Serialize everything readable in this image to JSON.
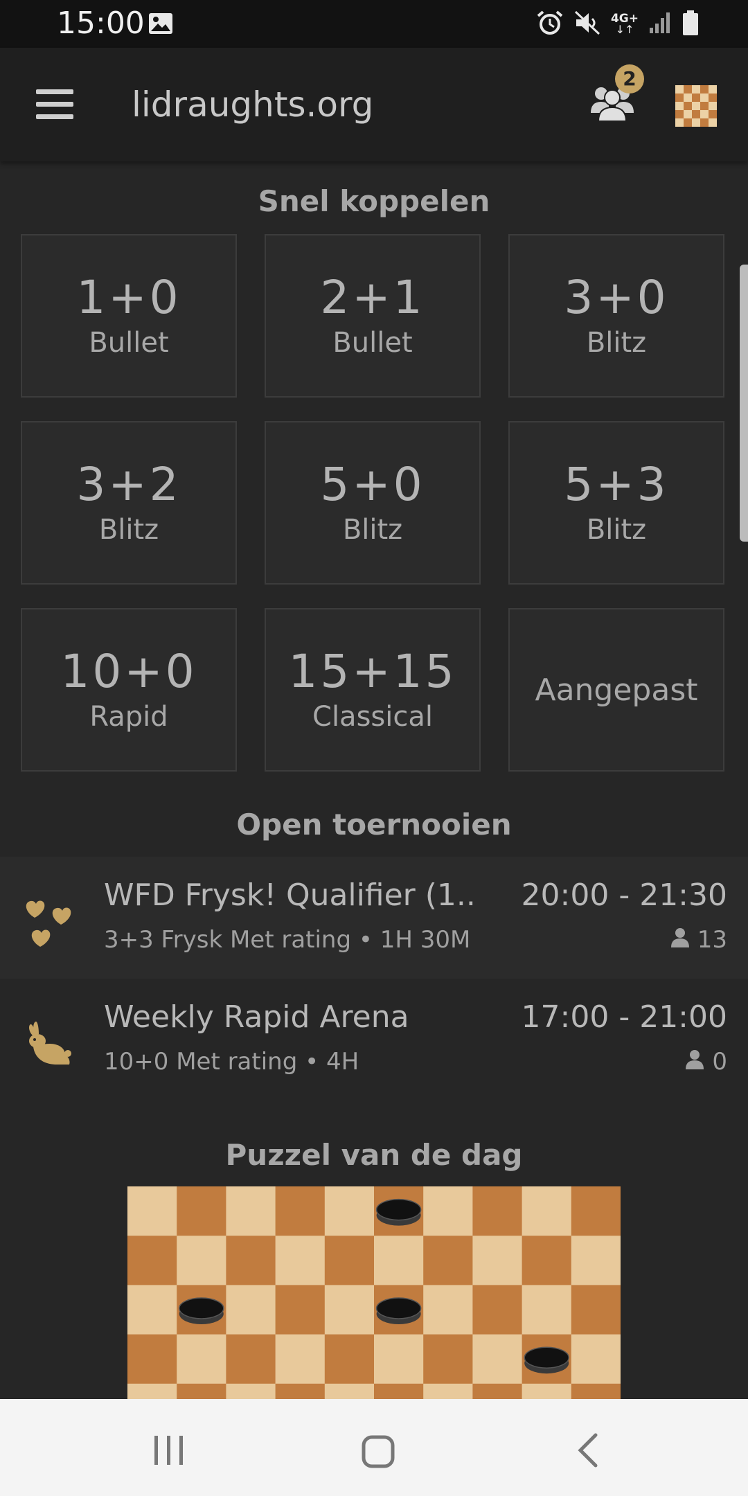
{
  "status_bar": {
    "time": "15:00",
    "network": "4G+"
  },
  "app_bar": {
    "title": "lidraughts.org",
    "friends_count": "2"
  },
  "quick_pairing": {
    "title": "Snel koppelen",
    "tiles": [
      {
        "clock": "1+0",
        "perf": "Bullet"
      },
      {
        "clock": "2+1",
        "perf": "Bullet"
      },
      {
        "clock": "3+0",
        "perf": "Blitz"
      },
      {
        "clock": "3+2",
        "perf": "Blitz"
      },
      {
        "clock": "5+0",
        "perf": "Blitz"
      },
      {
        "clock": "5+3",
        "perf": "Blitz"
      },
      {
        "clock": "10+0",
        "perf": "Rapid"
      },
      {
        "clock": "15+15",
        "perf": "Classical"
      }
    ],
    "custom_label": "Aangepast"
  },
  "tournaments": {
    "title": "Open toernooien",
    "items": [
      {
        "name": "WFD Frysk! Qualifier (1...",
        "details": "3+3 Frysk Met rating • 1H 30M",
        "time": "20:00 - 21:30",
        "players": "13",
        "icon": "frysk-icon"
      },
      {
        "name": "Weekly Rapid Arena",
        "details": "10+0 Met rating • 4H",
        "time": "17:00 - 21:00",
        "players": "0",
        "icon": "rabbit-icon"
      }
    ]
  },
  "puzzle": {
    "title": "Puzzel van de dag"
  },
  "colors": {
    "accent": "#c6a464",
    "background": "#262626",
    "board_light": "#e8c99b",
    "board_dark": "#c17c3f"
  }
}
